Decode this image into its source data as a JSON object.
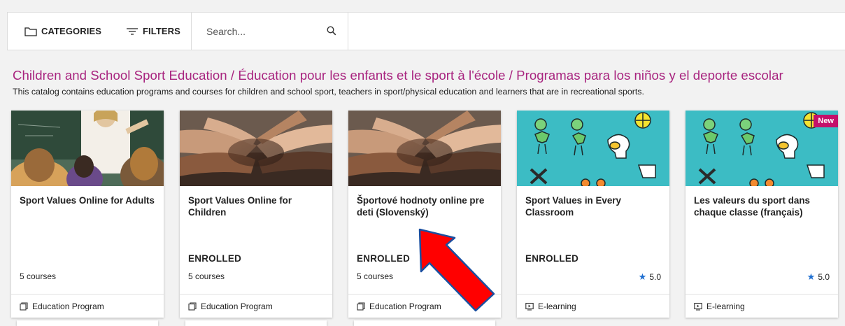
{
  "toolbar": {
    "categories_label": "CATEGORIES",
    "filters_label": "FILTERS",
    "search_placeholder": "Search..."
  },
  "catalog": {
    "title": "Children and School Sport Education / Éducation pour les enfants et le sport à l'école / Programas para los niños y el deporte escolar",
    "description": "This catalog contains education programs and courses for children and school sport, teachers in sport/physical education and learners that are in recreational sports."
  },
  "cards": [
    {
      "title": "Sport Values Online for Adults",
      "status": "",
      "count": "5 courses",
      "rating": "",
      "type": "Education Program",
      "type_icon": "program-icon",
      "image": "classroom-photo"
    },
    {
      "title": "Sport Values Online for Children",
      "status": "ENROLLED",
      "count": "5 courses",
      "rating": "",
      "type": "Education Program",
      "type_icon": "program-icon",
      "image": "stacked-hands-photo"
    },
    {
      "title": "Športové hodnoty online pre deti (Slovenský)",
      "status": "ENROLLED",
      "count": "5 courses",
      "rating": "",
      "type": "Education Program",
      "type_icon": "program-icon",
      "image": "stacked-hands-photo"
    },
    {
      "title": "Sport Values in Every Classroom",
      "status": "ENROLLED",
      "count": "",
      "rating": "5.0",
      "type": "E-learning",
      "type_icon": "elearning-icon",
      "image": "sport-values-illustration"
    },
    {
      "title": "Les valeurs du sport dans chaque classe (français)",
      "status": "",
      "count": "",
      "rating": "5.0",
      "type": "E-learning",
      "type_icon": "elearning-icon",
      "image": "sport-values-illustration",
      "badge": "New"
    }
  ],
  "annotation": {
    "type": "red-arrow",
    "color": "#ff0000"
  },
  "colors": {
    "accent": "#a8247f",
    "star": "#1f6fd1",
    "badge": "#c4106a",
    "illustration_bg": "#3cbcc4"
  }
}
